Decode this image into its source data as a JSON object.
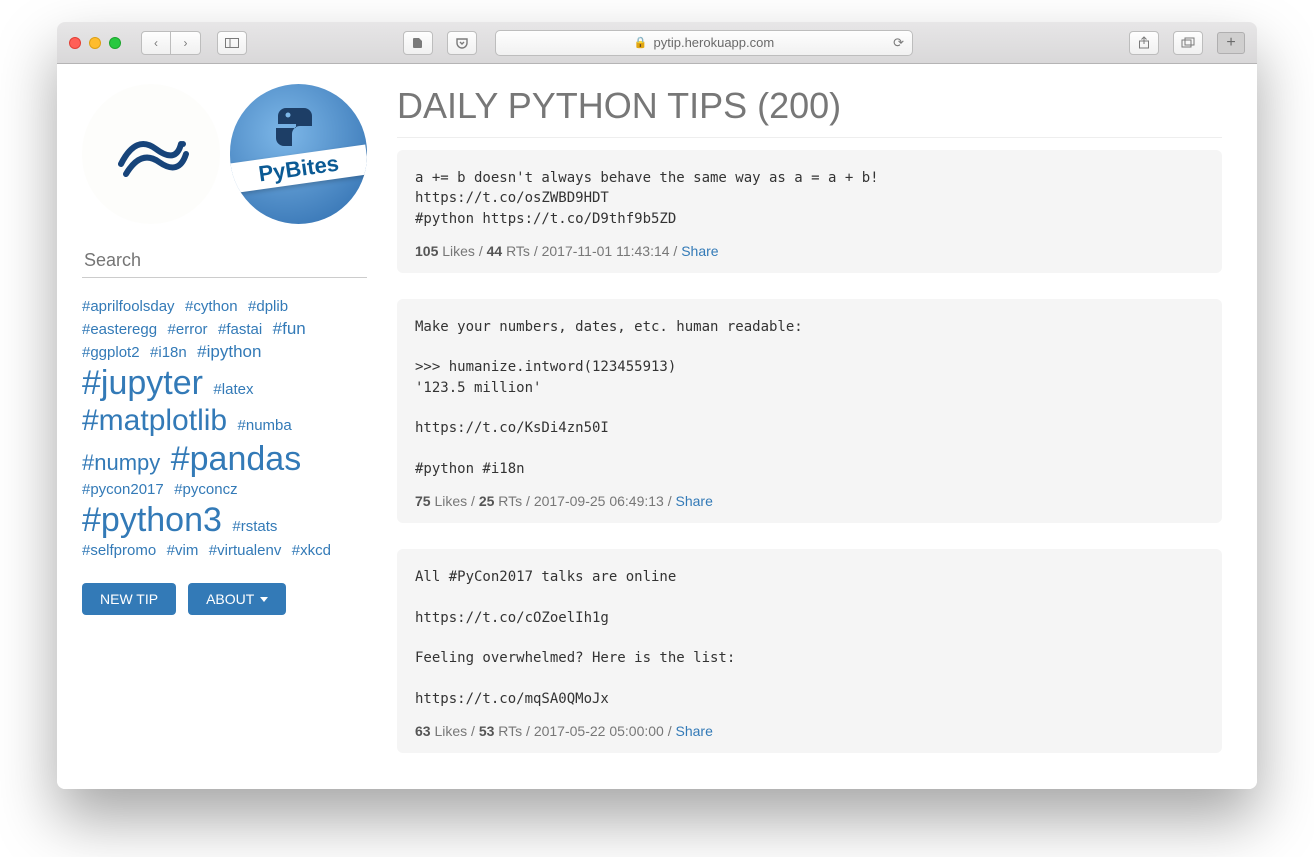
{
  "browser": {
    "url_display": "pytip.herokuapp.com"
  },
  "sidebar": {
    "logo_b_text": "PyBites",
    "search_placeholder": "Search",
    "tags": [
      {
        "text": "#aprilfoolsday",
        "sz": 1
      },
      {
        "text": "#cython",
        "sz": 1
      },
      {
        "text": "#dplib",
        "sz": 1
      },
      {
        "text": "#easteregg",
        "sz": 1
      },
      {
        "text": "#error",
        "sz": 1
      },
      {
        "text": "#fastai",
        "sz": 1
      },
      {
        "text": "#fun",
        "sz": 2
      },
      {
        "text": "#ggplot2",
        "sz": 1
      },
      {
        "text": "#i18n",
        "sz": 1
      },
      {
        "text": "#ipython",
        "sz": 2
      },
      {
        "text": "#jupyter",
        "sz": 5
      },
      {
        "text": "#latex",
        "sz": 1
      },
      {
        "text": "#matplotlib",
        "sz": 4
      },
      {
        "text": "#numba",
        "sz": 1
      },
      {
        "text": "#numpy",
        "sz": 3
      },
      {
        "text": "#pandas",
        "sz": 5
      },
      {
        "text": "#pycon2017",
        "sz": 1
      },
      {
        "text": "#pyconcz",
        "sz": 1
      },
      {
        "text": "#python3",
        "sz": 5
      },
      {
        "text": "#rstats",
        "sz": 1
      },
      {
        "text": "#selfpromo",
        "sz": 1
      },
      {
        "text": "#vim",
        "sz": 1
      },
      {
        "text": "#virtualenv",
        "sz": 1
      },
      {
        "text": "#xkcd",
        "sz": 1
      }
    ],
    "new_tip_label": "NEW TIP",
    "about_label": "ABOUT"
  },
  "main": {
    "title": "DAILY PYTHON TIPS (200)",
    "likes_word": "Likes",
    "rts_word": "RTs",
    "share_word": "Share",
    "tips": [
      {
        "body": "a += b doesn't always behave the same way as a = a + b!\nhttps://t.co/osZWBD9HDT\n#python https://t.co/D9thf9b5ZD",
        "likes": "105",
        "rts": "44",
        "ts": "2017-11-01 11:43:14"
      },
      {
        "body": "Make your numbers, dates, etc. human readable:\n\n>>> humanize.intword(123455913)\n'123.5 million'\n\nhttps://t.co/KsDi4zn50I\n\n#python #i18n",
        "likes": "75",
        "rts": "25",
        "ts": "2017-09-25 06:49:13"
      },
      {
        "body": "All #PyCon2017 talks are online\n\nhttps://t.co/cOZoelIh1g\n\nFeeling overwhelmed? Here is the list:\n\nhttps://t.co/mqSA0QMoJx",
        "likes": "63",
        "rts": "53",
        "ts": "2017-05-22 05:00:00"
      }
    ]
  }
}
